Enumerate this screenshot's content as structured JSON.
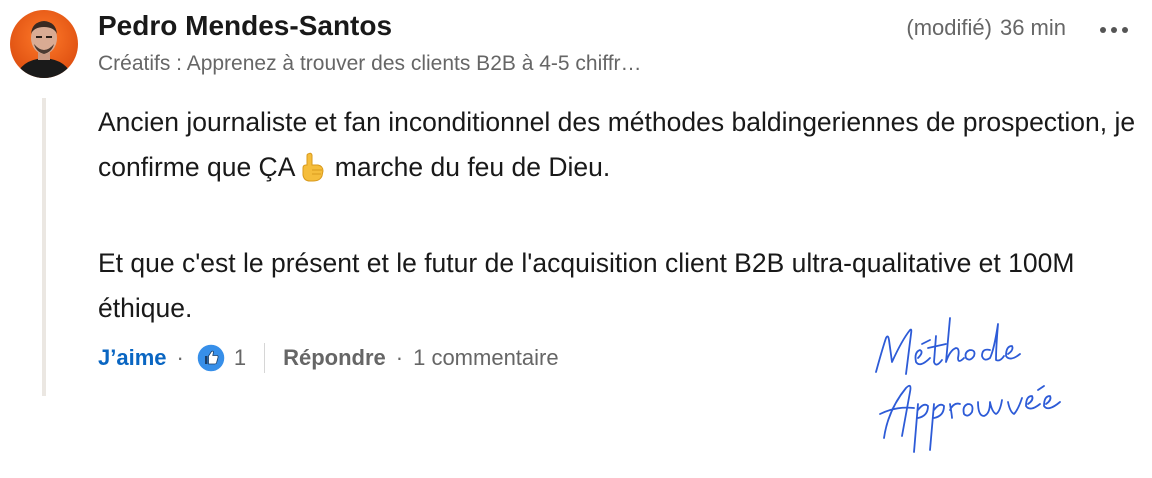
{
  "comment": {
    "author_name": "Pedro Mendes-Santos",
    "author_headline": "Créatifs : Apprenez à trouver des clients B2B à 4-5 chiffr…",
    "edited_label": "(modifié)",
    "time_ago": "36 min",
    "more_label": "•••",
    "paragraphs": [
      {
        "before_emoji": "Ancien journaliste et fan inconditionnel des méthodes baldingeriennes de prospection, je confirme que ÇA",
        "emoji": "pointing-up-hand",
        "after_emoji": "marche du feu de Dieu."
      },
      {
        "text": "Et que c'est le présent et le futur de l'acquisition client B2B ultra-qualitative et 100M éthique."
      }
    ]
  },
  "actions": {
    "like_label": "J’aime",
    "separator": "·",
    "reaction_icon": "like-thumb-icon",
    "reaction_count": "1",
    "reply_label": "Répondre",
    "comment_count": "1 commentaire"
  },
  "stamp": {
    "line1": "Méthode",
    "line2": "Approuvée",
    "color": "#2d5bd7"
  },
  "colors": {
    "accent": "#0a66c2",
    "muted": "#666666",
    "thread_line": "#ebe7e2"
  }
}
